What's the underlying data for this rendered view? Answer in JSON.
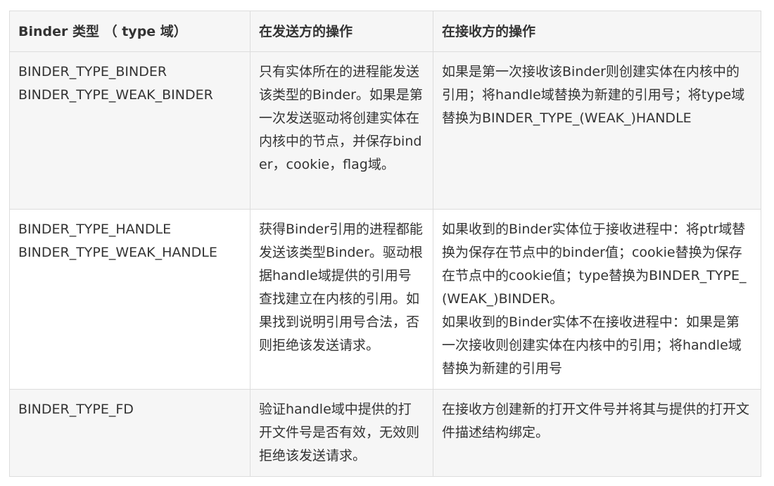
{
  "table": {
    "headers": [
      "Binder 类型 （ type 域）",
      "在发送方的操作",
      "在接收方的操作"
    ],
    "rows": [
      {
        "type_lines": [
          "BINDER_TYPE_BINDER",
          "BINDER_TYPE_WEAK_BINDER"
        ],
        "sender": "只有实体所在的进程能发送该类型的Binder。如果是第一次发送驱动将创建实体在内核中的节点，并保存binder，cookie，flag域。",
        "receiver_lines": [
          "如果是第一次接收该Binder则创建实体在内核中的引用；将handle域替换为新建的引用号；将type域替换为BINDER_TYPE_(WEAK_)HANDLE"
        ]
      },
      {
        "type_lines": [
          "BINDER_TYPE_HANDLE",
          "BINDER_TYPE_WEAK_HANDLE"
        ],
        "sender": "获得Binder引用的进程都能发送该类型Binder。驱动根据handle域提供的引用号查找建立在内核的引用。如果找到说明引用号合法，否则拒绝该发送请求。",
        "receiver_lines": [
          "如果收到的Binder实体位于接收进程中：将ptr域替换为保存在节点中的binder值；cookie替换为保存在节点中的cookie值；type替换为BINDER_TYPE_(WEAK_)BINDER。",
          "如果收到的Binder实体不在接收进程中：如果是第一次接收则创建实体在内核中的引用；将handle域替换为新建的引用号"
        ]
      },
      {
        "type_lines": [
          "BINDER_TYPE_FD"
        ],
        "sender": "验证handle域中提供的打开文件号是否有效，无效则拒绝该发送请求。",
        "receiver_lines": [
          "在接收方创建新的打开文件号并将其与提供的打开文件描述结构绑定。"
        ]
      }
    ]
  }
}
